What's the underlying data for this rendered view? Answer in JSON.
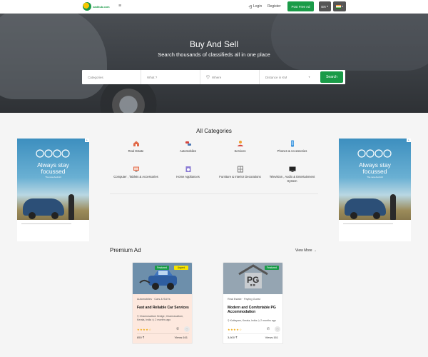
{
  "navbar": {
    "logo_text": "xadhub.com",
    "login": "Login",
    "register": "Register",
    "post_ad": "Post Free Ad",
    "language": "EN"
  },
  "hero": {
    "title": "Buy And Sell",
    "subtitle": "Search thousands of classifieds all in one place",
    "search": {
      "categories_placeholder": "Categories",
      "what_placeholder": "What ?",
      "where_placeholder": "Where",
      "distance_placeholder": "Distance in KM",
      "button": "Search"
    }
  },
  "categories": {
    "title": "All Categories",
    "items": [
      {
        "label": "Real Estate",
        "icon": "house-icon"
      },
      {
        "label": "Automobiles",
        "icon": "cars-icon"
      },
      {
        "label": "Services",
        "icon": "services-icon"
      },
      {
        "label": "Phones & Accessories",
        "icon": "phone-icon"
      },
      {
        "label": "Computer , Tablets & Accessories",
        "icon": "computer-icon"
      },
      {
        "label": "Home Appliances",
        "icon": "appliance-icon"
      },
      {
        "label": "Furniture & Interior Decorations",
        "icon": "furniture-icon"
      },
      {
        "label": "Television , Audio & Entertainment System",
        "icon": "television-icon"
      }
    ]
  },
  "ads": {
    "headline_line1": "Always stay",
    "headline_line2": "focussed",
    "small": "The new Audi A3"
  },
  "premium": {
    "title": "Premium Ad",
    "view_more": "View More",
    "cards": [
      {
        "badges": [
          "Featured",
          "Urgent"
        ],
        "category": "Automobiles · Cars & SUVs",
        "title": "Fast and Reliable Car Services",
        "location": "Chamravattom Bridge, Chamravattom, Kerala, India",
        "age": "2 months ago",
        "stars": "★★★★☆",
        "price": "850 ₹",
        "views": "Views:161"
      },
      {
        "badges": [
          "Featured"
        ],
        "category": "Real Estate · Paying Guest",
        "title": "Modern and Comfortable PG Accommodation",
        "location": "Kottayam, Kerala, India",
        "age": "2 months ago",
        "stars": "★★★★☆",
        "price": "3,600 ₹",
        "views": "Views:161"
      }
    ]
  }
}
